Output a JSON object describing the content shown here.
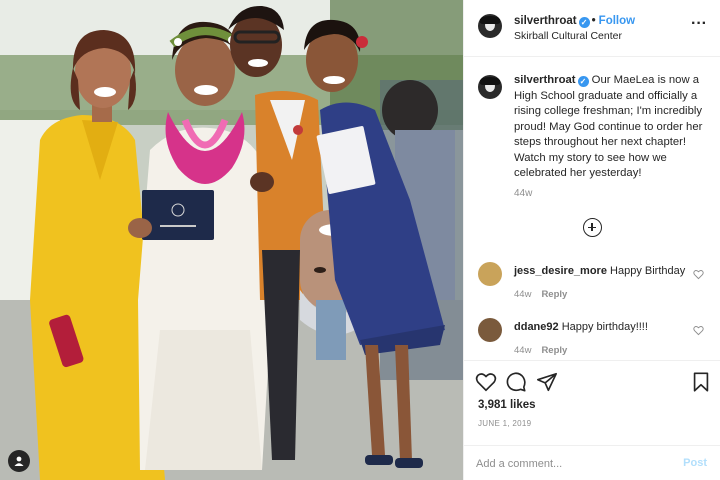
{
  "post": {
    "username": "silverthroat",
    "verified": true,
    "follow_label": "Follow",
    "header_separator": "•",
    "location": "Skirball Cultural Center",
    "caption": "Our MaeLea is now a High School graduate and officially a rising college freshman; I'm incredibly proud! May God continue to order her steps throughout her next chapter! Watch my story to see how we celebrated her yesterday!",
    "caption_age": "44w",
    "likes": "3,981 likes",
    "date": "JUNE 1, 2019"
  },
  "comments": [
    {
      "username": "jess_desire_more",
      "text": "Happy Birthday",
      "age": "44w",
      "reply_label": "Reply",
      "avatar_color": "#c9a35a"
    },
    {
      "username": "ddane92",
      "text": "Happy birthday!!!!",
      "age": "44w",
      "reply_label": "Reply",
      "avatar_color": "#7a5a3c"
    }
  ],
  "add_comment": {
    "placeholder": "Add a comment...",
    "post_label": "Post"
  },
  "icons": {
    "more": "more-options-icon",
    "verified": "verified-badge-icon",
    "load_more": "load-more-comments-icon",
    "like": "heart-icon",
    "comment": "comment-icon",
    "share": "share-icon",
    "save": "bookmark-icon",
    "user_tags": "user-tag-icon"
  },
  "colors": {
    "accent": "#3897f0",
    "muted": "#8e8e8e",
    "post_disabled": "#b2dffc",
    "border": "#efefef"
  }
}
